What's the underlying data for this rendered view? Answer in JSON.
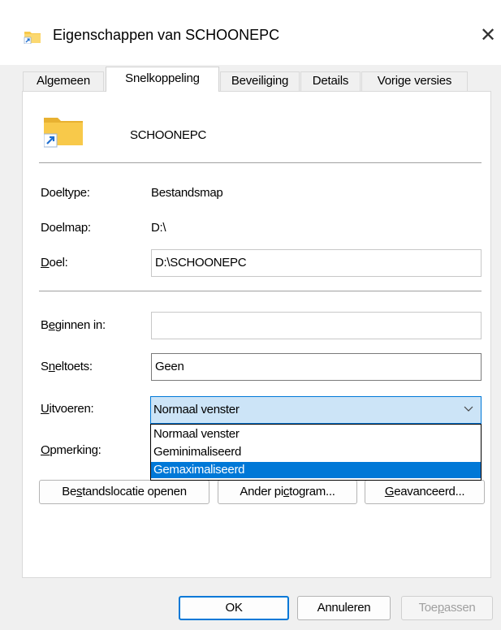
{
  "window": {
    "title": "Eigenschappen van SCHOONEPC",
    "close_glyph": "✕"
  },
  "tabs": [
    {
      "label": "Algemeen"
    },
    {
      "label": "Snelkoppeling"
    },
    {
      "label": "Beveiliging"
    },
    {
      "label": "Details"
    },
    {
      "label": "Vorige versies"
    }
  ],
  "active_tab": "Snelkoppeling",
  "shortcut": {
    "name": "SCHOONEPC"
  },
  "fields": {
    "doeltype_label": "Doeltype:",
    "doeltype_value": "Bestandsmap",
    "doelmap_label": "Doelmap:",
    "doelmap_value": "D:\\",
    "doel_label_mnemonic": "D",
    "doel_label_rest": "oel:",
    "doel_value": "D:\\SCHOONEPC",
    "beginnen_label_pre": "B",
    "beginnen_label_mnemonic": "e",
    "beginnen_label_rest": "ginnen in:",
    "beginnen_value": "",
    "sneltoets_label_pre": "S",
    "sneltoets_label_mnemonic": "n",
    "sneltoets_label_rest": "eltoets:",
    "sneltoets_value": "Geen",
    "uitvoeren_label_mnemonic": "U",
    "uitvoeren_label_rest": "itvoeren:",
    "uitvoeren_value": "Normaal venster",
    "opmerking_label_mnemonic": "O",
    "opmerking_label_rest": "pmerking:"
  },
  "run_options": [
    {
      "label": "Normaal venster"
    },
    {
      "label": "Geminimaliseerd"
    },
    {
      "label": "Gemaximaliseerd"
    }
  ],
  "run_options_highlighted": "Gemaximaliseerd",
  "action_buttons": {
    "open_location_pre": "Be",
    "open_location_mnemonic": "s",
    "open_location_rest": "tandslocatie openen",
    "change_icon_pre": "Ander pi",
    "change_icon_mnemonic": "c",
    "change_icon_rest": "togram...",
    "advanced_mnemonic": "G",
    "advanced_rest": "eavanceerd..."
  },
  "footer_buttons": {
    "ok": "OK",
    "cancel": "Annuleren",
    "apply_pre": "Toe",
    "apply_mnemonic": "p",
    "apply_rest": "assen"
  },
  "colors": {
    "accent": "#0078d7",
    "folder_yellow": "#f8c94a",
    "combo_background": "#cce4f7"
  }
}
